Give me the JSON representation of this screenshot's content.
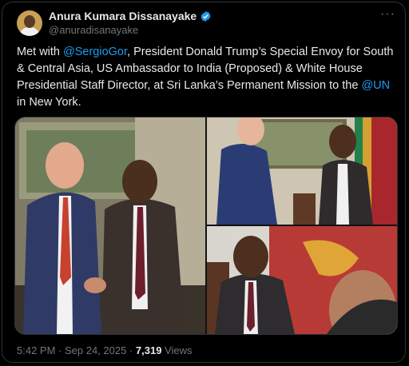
{
  "author": {
    "name": "Anura Kumara Dissanayake",
    "handle": "@anuradisanayake"
  },
  "post": {
    "parts": [
      {
        "text": "Met with ",
        "link": false
      },
      {
        "text": "@SergioGor",
        "link": true
      },
      {
        "text": ", President Donald Trump’s Special Envoy for South & Central Asia, US Ambassador to India (Proposed) & White House Presidential Staff Director, at Sri Lanka’s Permanent Mission to the ",
        "link": false
      },
      {
        "text": "@UN",
        "link": true
      },
      {
        "text": " in New York.",
        "link": false
      }
    ]
  },
  "meta": {
    "time": "5:42 PM",
    "sep1": " · ",
    "date": "Sep 24, 2025",
    "sep2": " · ",
    "views_count": "7,319",
    "views_label": " Views"
  },
  "icons": {
    "verified": "verified-badge-icon",
    "more": "more-options-icon"
  },
  "colors": {
    "link": "#1d9bf0",
    "muted": "#71767b",
    "background": "#000000"
  }
}
